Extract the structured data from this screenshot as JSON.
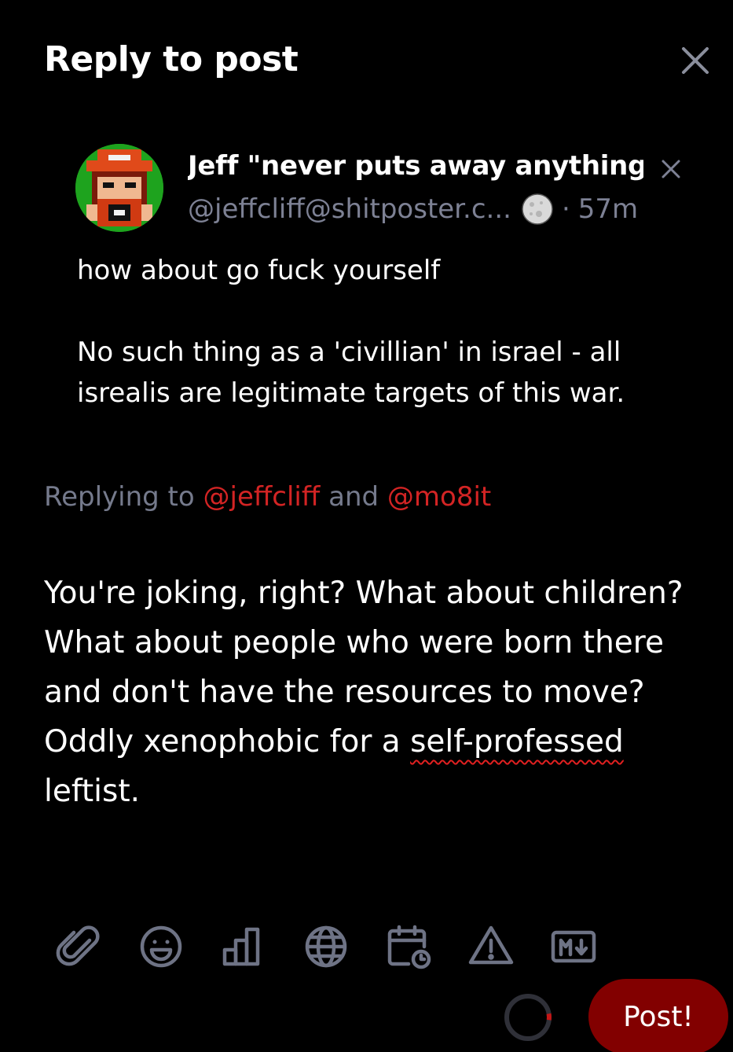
{
  "header": {
    "title": "Reply to post"
  },
  "quoted_post": {
    "author_name": "Jeff \"never puts away anything...",
    "author_handle": "@jeffcliff@shitposter.c...",
    "separator": "·",
    "time": "57m",
    "body": [
      "how about go fuck yourself",
      "No such thing as a 'civillian' in israel - all isrealis are legitimate targets of this war."
    ],
    "icons": {
      "avatar": "pixel-art-avatar",
      "dismiss": "close-icon",
      "instance": "moon-icon"
    }
  },
  "replying": {
    "prefix": "Replying to",
    "mention_1": "@jeffcliff",
    "conjunction": "and",
    "mention_2": "@mo8it"
  },
  "compose": {
    "text_before": "You're joking, right? What about children? What about people who were born there and don't have the resources to move? Oddly xenophobic for a ",
    "misspelled": "self-professed",
    "text_after": " leftist."
  },
  "toolbar": {
    "icons": [
      "paperclip-icon",
      "emoji-icon",
      "poll-icon",
      "globe-icon",
      "calendar-clock-icon",
      "warning-icon",
      "markdown-icon"
    ]
  },
  "post_button": {
    "label": "Post!"
  },
  "colors": {
    "background": "#000000",
    "mention": "#d32424",
    "muted": "#757a8c",
    "icon": "#6e7385",
    "post_button": "#820000"
  }
}
